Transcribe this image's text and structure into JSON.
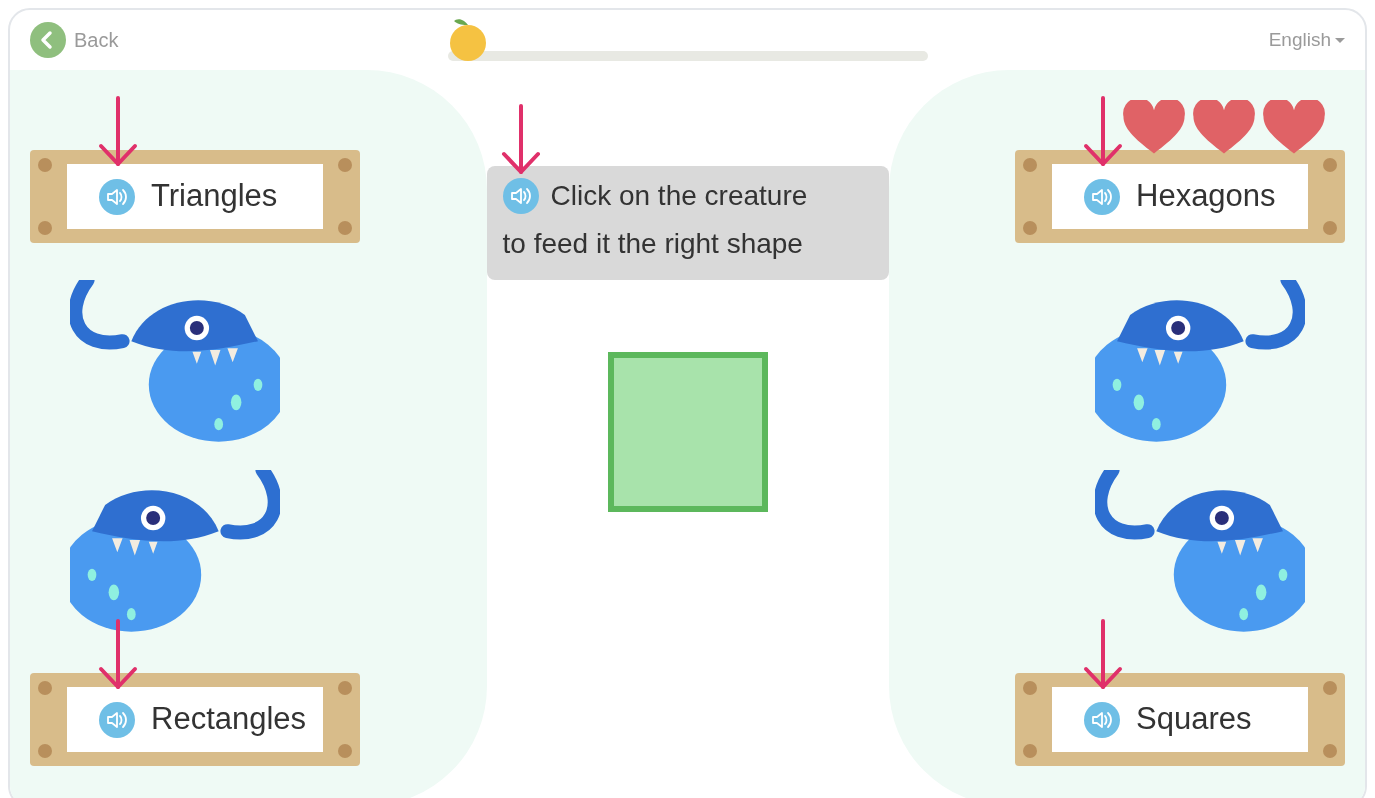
{
  "top_bar": {
    "back": "Back",
    "progress": {
      "level": 0
    },
    "language": "English"
  },
  "lives": [
    {
      "filled": true
    },
    {
      "filled": true
    },
    {
      "filled": true
    }
  ],
  "left_signs": [
    {
      "label": "Triangles"
    },
    {
      "label": "Rectangles"
    }
  ],
  "right_signs": [
    {
      "label": "Hexagons"
    },
    {
      "label": "Squares"
    }
  ],
  "instruction_lines": [
    "Click on the creature",
    "to feed it the right shape"
  ],
  "shape": {
    "kind": "square"
  }
}
